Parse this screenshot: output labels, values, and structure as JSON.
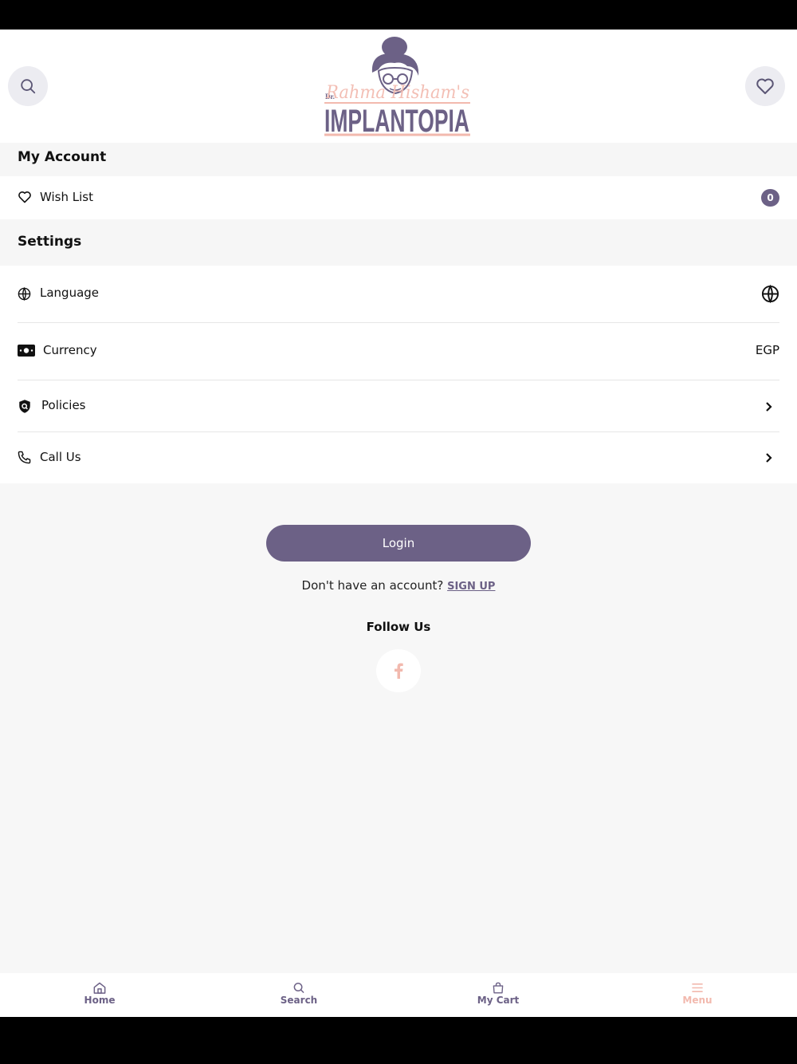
{
  "header": {
    "logo": {
      "prefix": "Dr.",
      "script_text": "Rahma Hisham's",
      "wordmark": "IMPLANTOPIA"
    },
    "search_icon": "search-icon",
    "wishlist_icon": "heart-icon"
  },
  "account": {
    "title": "My Account",
    "wish_list_label": "Wish List",
    "wish_list_count": "0"
  },
  "settings": {
    "title": "Settings",
    "language_label": "Language",
    "currency_label": "Currency",
    "currency_value": "EGP",
    "policies_label": "Policies",
    "call_us_label": "Call Us"
  },
  "auth": {
    "login_label": "Login",
    "no_account_text": "Don't have an account?",
    "signup_label": "SIGN UP"
  },
  "social": {
    "follow_title": "Follow Us",
    "facebook_icon": "facebook-icon"
  },
  "tabbar": {
    "home": "Home",
    "search": "Search",
    "cart": "My Cart",
    "menu": "Menu",
    "active": "menu"
  },
  "colors": {
    "accent": "#6c6186",
    "accent_soft": "#f2b9ae",
    "background": "#f7f7f7"
  }
}
